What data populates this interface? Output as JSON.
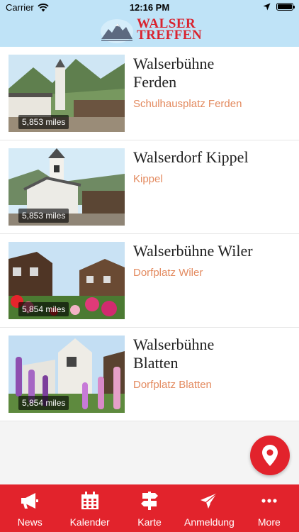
{
  "status_bar": {
    "carrier": "Carrier",
    "time": "12:16 PM"
  },
  "header": {
    "logo_line1": "WALSER",
    "logo_line2": "TREFFEN"
  },
  "colors": {
    "header_bg": "#bfe3f7",
    "brand_red": "#e2232c",
    "subtitle_orange": "#e38a5f"
  },
  "events": [
    {
      "title_line1": "Walserbühne",
      "title_line2": "Ferden",
      "location": "Schulhausplatz Ferden",
      "distance": "5,853 miles"
    },
    {
      "title_line1": "Walserdorf Kippel",
      "title_line2": "",
      "location": "Kippel",
      "distance": "5,853 miles"
    },
    {
      "title_line1": "Walserbühne Wiler",
      "title_line2": "",
      "location": "Dorfplatz Wiler",
      "distance": "5,854 miles"
    },
    {
      "title_line1": "Walserbühne",
      "title_line2": "Blatten",
      "location": "Dorfplatz Blatten",
      "distance": "5,854 miles"
    }
  ],
  "map_button_icon": "map-pin-icon",
  "tabs": [
    {
      "label": "News",
      "icon": "megaphone-icon"
    },
    {
      "label": "Kalender",
      "icon": "calendar-icon"
    },
    {
      "label": "Karte",
      "icon": "signpost-icon"
    },
    {
      "label": "Anmeldung",
      "icon": "paper-plane-icon"
    },
    {
      "label": "More",
      "icon": "more-dots-icon"
    }
  ]
}
